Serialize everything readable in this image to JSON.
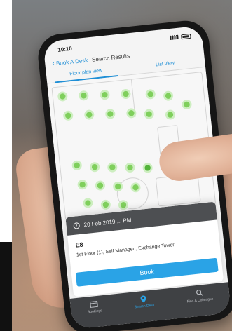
{
  "status_bar": {
    "time": "10:10"
  },
  "nav": {
    "back_label": "Book A Desk",
    "title": "Search Results"
  },
  "tabs": [
    {
      "label": "Floor plan view",
      "active": true
    },
    {
      "label": "List view",
      "active": false
    }
  ],
  "floorplan": {
    "desk_color": "#7fcf5c",
    "selected_desk_color": "#53b43a"
  },
  "booking_card": {
    "date_time": "20 Feb 2019 ... PM",
    "desk_code": "E8",
    "location": "1st Floor (1), Self Managed, Exchange Tower",
    "book_label": "Book"
  },
  "bottom_nav": [
    {
      "label": "Bookings",
      "icon": "bookings-icon",
      "active": false
    },
    {
      "label": "Search Desk",
      "icon": "location-pin-icon",
      "active": true
    },
    {
      "label": "Find A Colleague",
      "icon": "search-icon",
      "active": false
    }
  ],
  "colors": {
    "accent": "#2aa3e6",
    "card_header": "#4d4f52",
    "nav_bg": "#3f4144"
  }
}
